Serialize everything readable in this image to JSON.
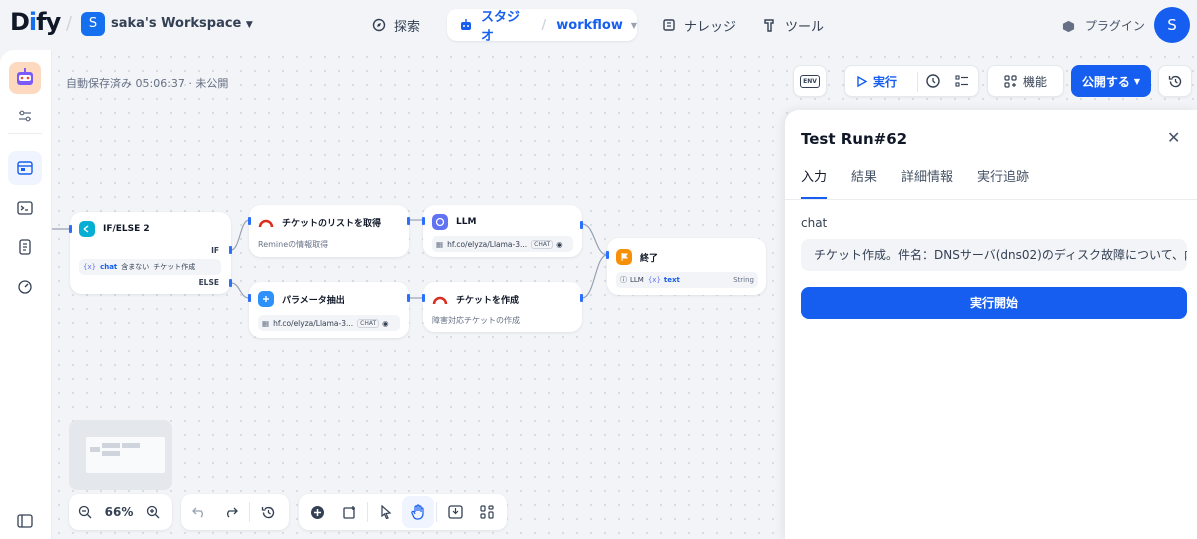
{
  "header": {
    "logo_text": "Dify",
    "workspace_initial": "S",
    "workspace_name": "saka's Workspace",
    "nav": {
      "explore": "探索",
      "studio": "スタジオ",
      "studio_app": "workflow",
      "knowledge": "ナレッジ",
      "tools": "ツール"
    },
    "plugins": "プラグイン",
    "user_initial": "S"
  },
  "canvas": {
    "autosave": "自動保存済み 05:06:37 · 未公開"
  },
  "toolbar": {
    "env_label": "ENV",
    "run_label": "実行",
    "features_label": "機能",
    "publish_label": "公開する"
  },
  "nodes": {
    "ifelse": {
      "title": "IF/ELSE 2",
      "if_label": "IF",
      "else_label": "ELSE",
      "var": "chat",
      "op": "含まない",
      "value": "チケット作成"
    },
    "get_list": {
      "title": "チケットのリストを取得",
      "desc": "Remineの情報取得"
    },
    "llm": {
      "title": "LLM",
      "model": "hf.co/elyza/Llama-3...",
      "mode": "CHAT"
    },
    "param": {
      "title": "パラメータ抽出",
      "model": "hf.co/elyza/Llama-3...",
      "mode": "CHAT"
    },
    "create": {
      "title": "チケットを作成",
      "desc": "障害対応チケットの作成"
    },
    "end": {
      "title": "終了",
      "source": "LLM",
      "var": "text",
      "type": "String"
    }
  },
  "controls": {
    "zoom": "66%"
  },
  "panel": {
    "title": "Test Run#62",
    "tabs": [
      "入力",
      "結果",
      "詳細情報",
      "実行追跡"
    ],
    "field_label": "chat",
    "field_value": "チケット作成。件名：DNSサーバ(dns02)のディスク故障について、内容",
    "start_button": "実行開始"
  },
  "colors": {
    "primary": "#155eef",
    "ifelse_icon": "#06aed4",
    "llm_icon": "#6172f3",
    "param_icon": "#2e90fa",
    "end_icon": "#f79009",
    "http_icon": "#d92d20"
  }
}
